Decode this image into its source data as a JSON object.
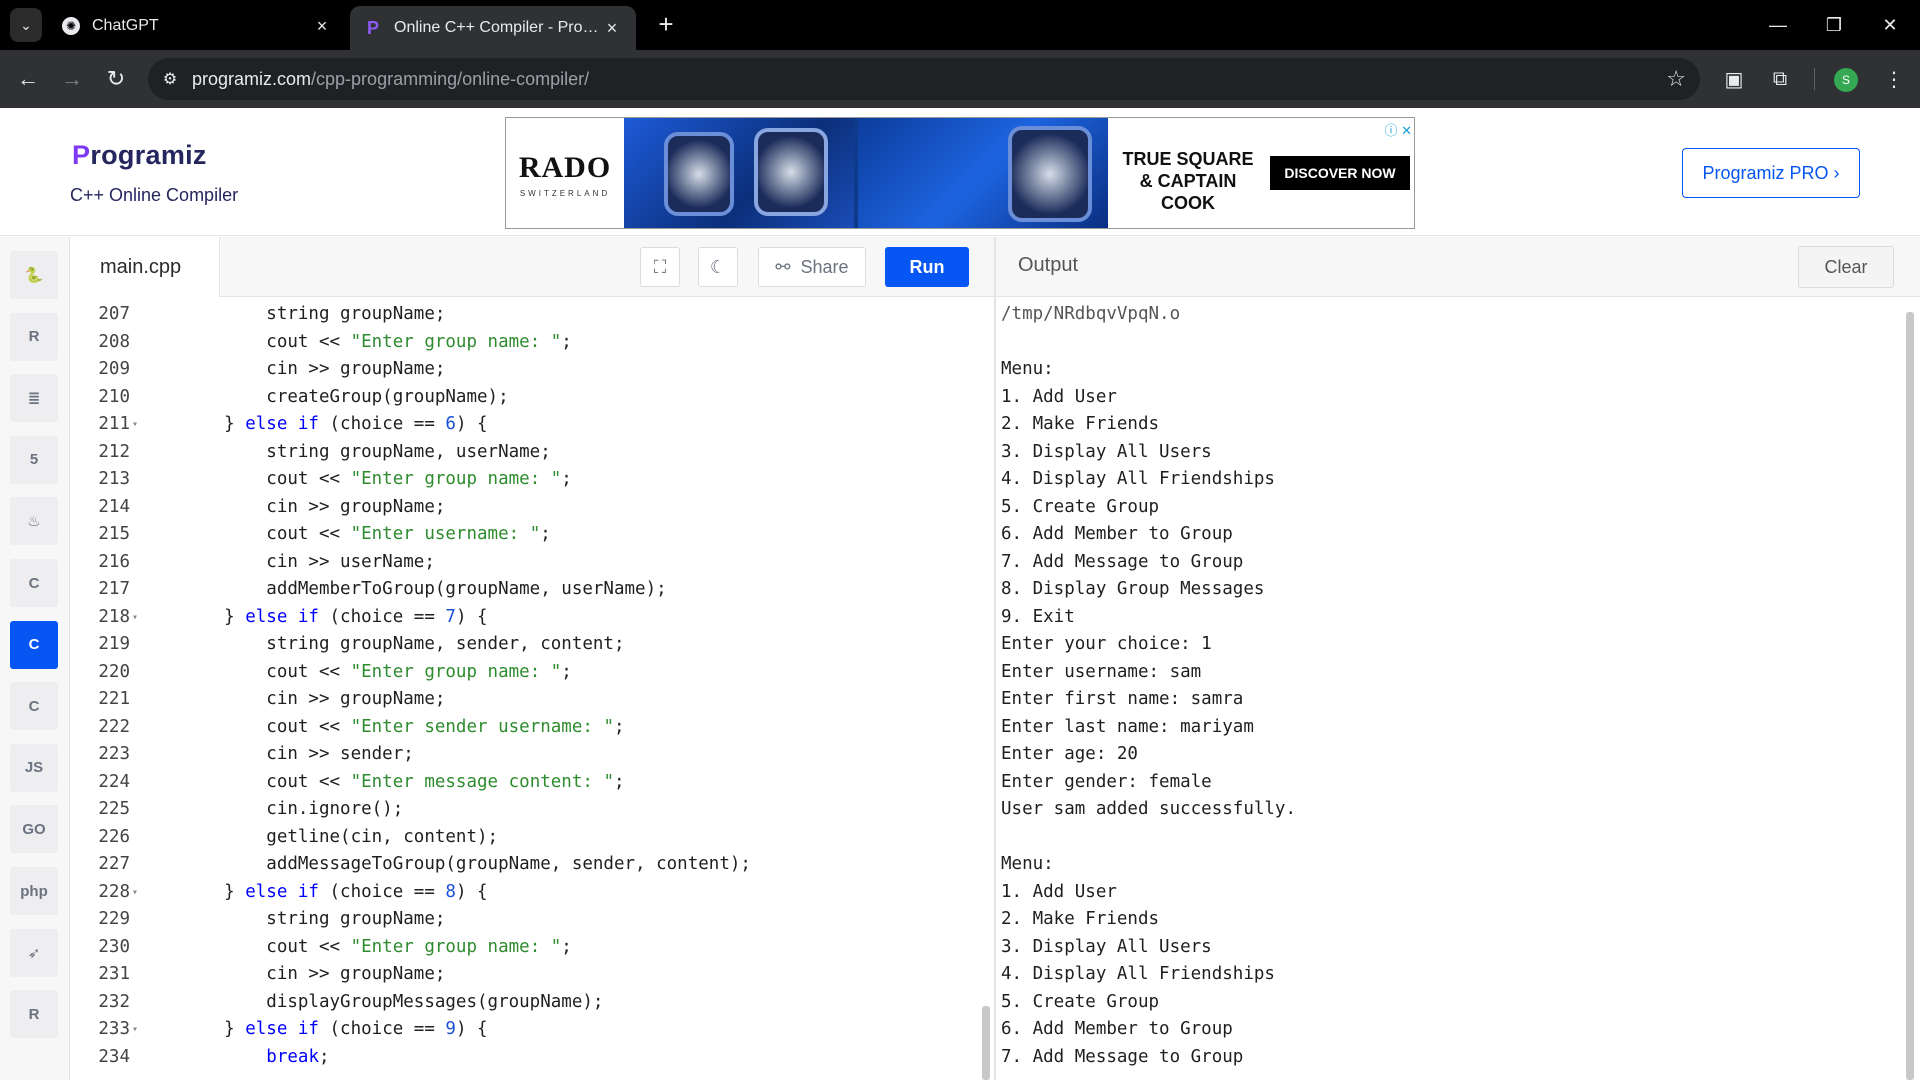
{
  "browser": {
    "tabs": [
      {
        "title": "ChatGPT",
        "active": false
      },
      {
        "title": "Online C++ Compiler - Programiz",
        "active": true
      }
    ],
    "url_host": "programiz.com",
    "url_path": "/cpp-programming/online-compiler/",
    "profile_initial": "S"
  },
  "header": {
    "logo_text": "rogramiz",
    "logo_initial": "P",
    "subtitle": "C++ Online Compiler",
    "pro_button": "Programiz PRO ›"
  },
  "ad": {
    "brand": "RADO",
    "brand_sub": "SWITZERLAND",
    "headline": "TRUE SQUARE & CAPTAIN COOK",
    "cta": "DISCOVER NOW"
  },
  "sidebar": {
    "languages": [
      {
        "name": "python",
        "glyph": "🐍",
        "active": false
      },
      {
        "name": "r",
        "glyph": "R",
        "active": false
      },
      {
        "name": "sql",
        "glyph": "≣",
        "active": false
      },
      {
        "name": "html",
        "glyph": "5",
        "active": false
      },
      {
        "name": "java",
        "glyph": "♨",
        "active": false
      },
      {
        "name": "c",
        "glyph": "C",
        "active": false
      },
      {
        "name": "cpp",
        "glyph": "C",
        "active": true
      },
      {
        "name": "csharp",
        "glyph": "C",
        "active": false
      },
      {
        "name": "js",
        "glyph": "JS",
        "active": false
      },
      {
        "name": "go",
        "glyph": "GO",
        "active": false
      },
      {
        "name": "php",
        "glyph": "php",
        "active": false
      },
      {
        "name": "swift",
        "glyph": "➶",
        "active": false
      },
      {
        "name": "rust",
        "glyph": "R",
        "active": false
      }
    ]
  },
  "editor": {
    "filename": "main.cpp",
    "share_label": "Share",
    "run_label": "Run",
    "lines": [
      {
        "n": "207",
        "fold": false,
        "segs": [
          [
            "t",
            "        string groupName;"
          ]
        ]
      },
      {
        "n": "208",
        "fold": false,
        "segs": [
          [
            "t",
            "        cout << "
          ],
          [
            "s",
            "\"Enter group name: \""
          ],
          [
            "t",
            ";"
          ]
        ]
      },
      {
        "n": "209",
        "fold": false,
        "segs": [
          [
            "t",
            "        cin >> groupName;"
          ]
        ]
      },
      {
        "n": "210",
        "fold": false,
        "segs": [
          [
            "t",
            "        createGroup(groupName);"
          ]
        ]
      },
      {
        "n": "211",
        "fold": true,
        "segs": [
          [
            "t",
            "    } "
          ],
          [
            "k",
            "else if"
          ],
          [
            "t",
            " (choice == "
          ],
          [
            "n",
            "6"
          ],
          [
            "t",
            ") {"
          ]
        ]
      },
      {
        "n": "212",
        "fold": false,
        "segs": [
          [
            "t",
            "        string groupName, userName;"
          ]
        ]
      },
      {
        "n": "213",
        "fold": false,
        "segs": [
          [
            "t",
            "        cout << "
          ],
          [
            "s",
            "\"Enter group name: \""
          ],
          [
            "t",
            ";"
          ]
        ]
      },
      {
        "n": "214",
        "fold": false,
        "segs": [
          [
            "t",
            "        cin >> groupName;"
          ]
        ]
      },
      {
        "n": "215",
        "fold": false,
        "segs": [
          [
            "t",
            "        cout << "
          ],
          [
            "s",
            "\"Enter username: \""
          ],
          [
            "t",
            ";"
          ]
        ]
      },
      {
        "n": "216",
        "fold": false,
        "segs": [
          [
            "t",
            "        cin >> userName;"
          ]
        ]
      },
      {
        "n": "217",
        "fold": false,
        "segs": [
          [
            "t",
            "        addMemberToGroup(groupName, userName);"
          ]
        ]
      },
      {
        "n": "218",
        "fold": true,
        "segs": [
          [
            "t",
            "    } "
          ],
          [
            "k",
            "else if"
          ],
          [
            "t",
            " (choice == "
          ],
          [
            "n",
            "7"
          ],
          [
            "t",
            ") {"
          ]
        ]
      },
      {
        "n": "219",
        "fold": false,
        "segs": [
          [
            "t",
            "        string groupName, sender, content;"
          ]
        ]
      },
      {
        "n": "220",
        "fold": false,
        "segs": [
          [
            "t",
            "        cout << "
          ],
          [
            "s",
            "\"Enter group name: \""
          ],
          [
            "t",
            ";"
          ]
        ]
      },
      {
        "n": "221",
        "fold": false,
        "segs": [
          [
            "t",
            "        cin >> groupName;"
          ]
        ]
      },
      {
        "n": "222",
        "fold": false,
        "segs": [
          [
            "t",
            "        cout << "
          ],
          [
            "s",
            "\"Enter sender username: \""
          ],
          [
            "t",
            ";"
          ]
        ]
      },
      {
        "n": "223",
        "fold": false,
        "segs": [
          [
            "t",
            "        cin >> sender;"
          ]
        ]
      },
      {
        "n": "224",
        "fold": false,
        "segs": [
          [
            "t",
            "        cout << "
          ],
          [
            "s",
            "\"Enter message content: \""
          ],
          [
            "t",
            ";"
          ]
        ]
      },
      {
        "n": "225",
        "fold": false,
        "segs": [
          [
            "t",
            "        cin.ignore();"
          ]
        ]
      },
      {
        "n": "226",
        "fold": false,
        "segs": [
          [
            "t",
            "        getline(cin, content);"
          ]
        ]
      },
      {
        "n": "227",
        "fold": false,
        "segs": [
          [
            "t",
            "        addMessageToGroup(groupName, sender, content);"
          ]
        ]
      },
      {
        "n": "228",
        "fold": true,
        "segs": [
          [
            "t",
            "    } "
          ],
          [
            "k",
            "else if"
          ],
          [
            "t",
            " (choice == "
          ],
          [
            "n",
            "8"
          ],
          [
            "t",
            ") {"
          ]
        ]
      },
      {
        "n": "229",
        "fold": false,
        "segs": [
          [
            "t",
            "        string groupName;"
          ]
        ]
      },
      {
        "n": "230",
        "fold": false,
        "segs": [
          [
            "t",
            "        cout << "
          ],
          [
            "s",
            "\"Enter group name: \""
          ],
          [
            "t",
            ";"
          ]
        ]
      },
      {
        "n": "231",
        "fold": false,
        "segs": [
          [
            "t",
            "        cin >> groupName;"
          ]
        ]
      },
      {
        "n": "232",
        "fold": false,
        "segs": [
          [
            "t",
            "        displayGroupMessages(groupName);"
          ]
        ]
      },
      {
        "n": "233",
        "fold": true,
        "segs": [
          [
            "t",
            "    } "
          ],
          [
            "k",
            "else if"
          ],
          [
            "t",
            " (choice == "
          ],
          [
            "n",
            "9"
          ],
          [
            "t",
            ") {"
          ]
        ]
      },
      {
        "n": "234",
        "fold": false,
        "segs": [
          [
            "t",
            "        "
          ],
          [
            "k",
            "break"
          ],
          [
            "t",
            ";"
          ]
        ]
      }
    ]
  },
  "output": {
    "label": "Output",
    "clear_label": "Clear",
    "lines": [
      "/tmp/NRdbqvVpqN.o",
      "",
      "Menu:",
      "1. Add User",
      "2. Make Friends",
      "3. Display All Users",
      "4. Display All Friendships",
      "5. Create Group",
      "6. Add Member to Group",
      "7. Add Message to Group",
      "8. Display Group Messages",
      "9. Exit",
      "Enter your choice: 1",
      "Enter username: sam",
      "Enter first name: samra",
      "Enter last name: mariyam",
      "Enter age: 20",
      "Enter gender: female",
      "User sam added successfully.",
      "",
      "Menu:",
      "1. Add User",
      "2. Make Friends",
      "3. Display All Users",
      "4. Display All Friendships",
      "5. Create Group",
      "6. Add Member to Group",
      "7. Add Message to Group"
    ]
  }
}
